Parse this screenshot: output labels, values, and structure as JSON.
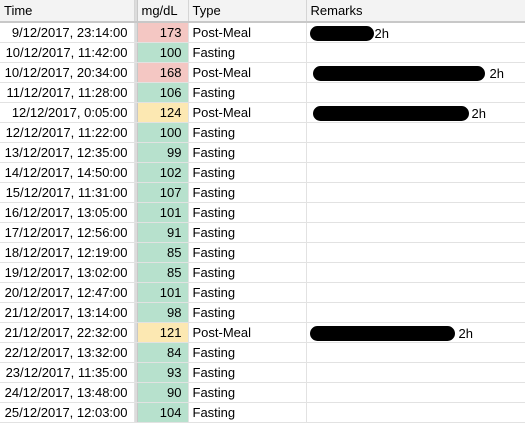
{
  "headers": {
    "time": "Time",
    "value": "mg/dL",
    "type": "Type",
    "remarks": "Remarks"
  },
  "colors": {
    "high": "#f4c7c3",
    "medium": "#fce8b2",
    "normal": "#b7e1cd"
  },
  "rows": [
    {
      "time": "9/12/2017, 23:14:00",
      "value": "173",
      "level": "high",
      "type": "Post-Meal",
      "remark": "2h",
      "redacted": true
    },
    {
      "time": "10/12/2017, 11:42:00",
      "value": "100",
      "level": "normal",
      "type": "Fasting",
      "remark": "",
      "redacted": false
    },
    {
      "time": "10/12/2017, 20:34:00",
      "value": "168",
      "level": "high",
      "type": "Post-Meal",
      "remark": "2h",
      "redacted": true
    },
    {
      "time": "11/12/2017, 11:28:00",
      "value": "106",
      "level": "normal",
      "type": "Fasting",
      "remark": "",
      "redacted": false
    },
    {
      "time": "12/12/2017, 0:05:00",
      "value": "124",
      "level": "medium",
      "type": "Post-Meal",
      "remark": "2h",
      "redacted": true
    },
    {
      "time": "12/12/2017, 11:22:00",
      "value": "100",
      "level": "normal",
      "type": "Fasting",
      "remark": "",
      "redacted": false
    },
    {
      "time": "13/12/2017, 12:35:00",
      "value": "99",
      "level": "normal",
      "type": "Fasting",
      "remark": "",
      "redacted": false
    },
    {
      "time": "14/12/2017, 14:50:00",
      "value": "102",
      "level": "normal",
      "type": "Fasting",
      "remark": "",
      "redacted": false
    },
    {
      "time": "15/12/2017, 11:31:00",
      "value": "107",
      "level": "normal",
      "type": "Fasting",
      "remark": "",
      "redacted": false
    },
    {
      "time": "16/12/2017, 13:05:00",
      "value": "101",
      "level": "normal",
      "type": "Fasting",
      "remark": "",
      "redacted": false
    },
    {
      "time": "17/12/2017, 12:56:00",
      "value": "91",
      "level": "normal",
      "type": "Fasting",
      "remark": "",
      "redacted": false
    },
    {
      "time": "18/12/2017, 12:19:00",
      "value": "85",
      "level": "normal",
      "type": "Fasting",
      "remark": "",
      "redacted": false
    },
    {
      "time": "19/12/2017, 13:02:00",
      "value": "85",
      "level": "normal",
      "type": "Fasting",
      "remark": "",
      "redacted": false
    },
    {
      "time": "20/12/2017, 12:47:00",
      "value": "101",
      "level": "normal",
      "type": "Fasting",
      "remark": "",
      "redacted": false
    },
    {
      "time": "21/12/2017, 13:14:00",
      "value": "98",
      "level": "normal",
      "type": "Fasting",
      "remark": "",
      "redacted": false
    },
    {
      "time": "21/12/2017, 22:32:00",
      "value": "121",
      "level": "medium",
      "type": "Post-Meal",
      "remark": "2h",
      "redacted": true
    },
    {
      "time": "22/12/2017, 13:32:00",
      "value": "84",
      "level": "normal",
      "type": "Fasting",
      "remark": "",
      "redacted": false
    },
    {
      "time": "23/12/2017, 11:35:00",
      "value": "93",
      "level": "normal",
      "type": "Fasting",
      "remark": "",
      "redacted": false
    },
    {
      "time": "24/12/2017, 13:48:00",
      "value": "90",
      "level": "normal",
      "type": "Fasting",
      "remark": "",
      "redacted": false
    },
    {
      "time": "25/12/2017, 12:03:00",
      "value": "104",
      "level": "normal",
      "type": "Fasting",
      "remark": "",
      "redacted": false
    }
  ]
}
